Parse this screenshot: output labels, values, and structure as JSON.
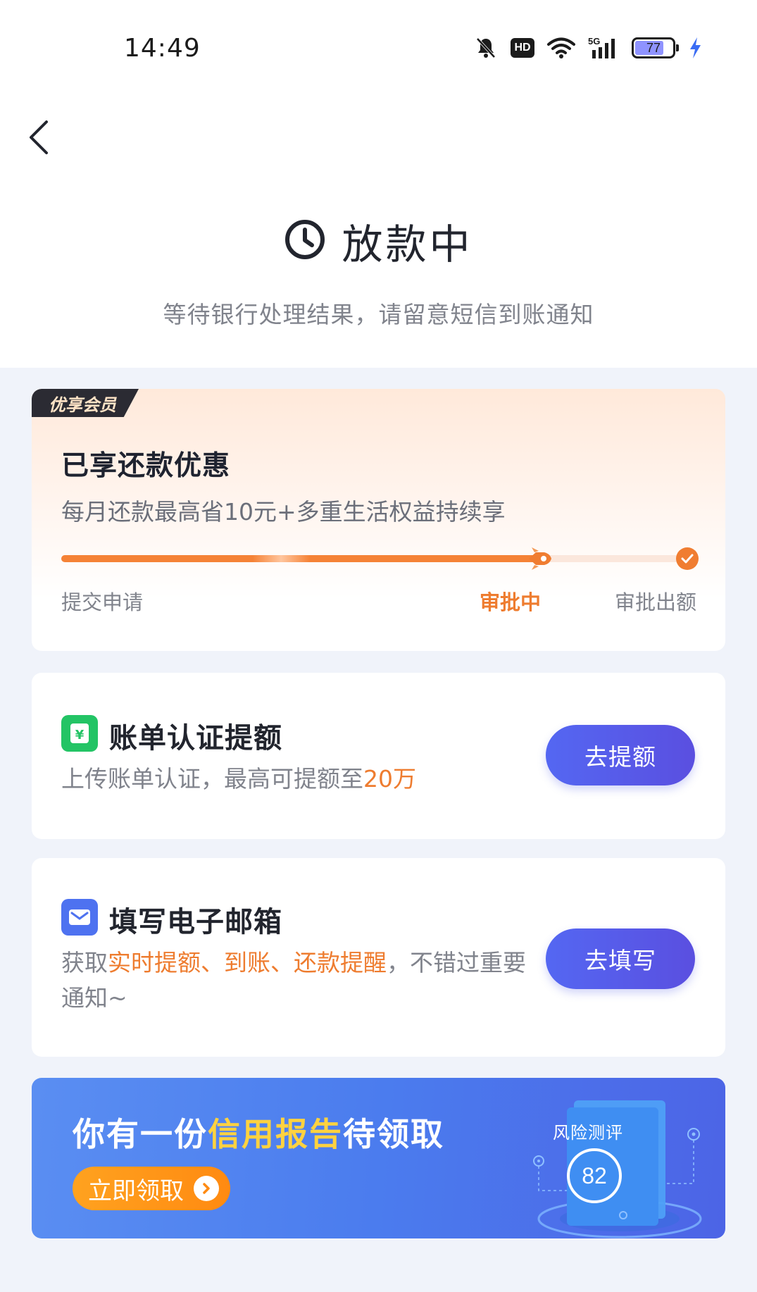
{
  "status_bar": {
    "time": "14:49",
    "network": "5G",
    "battery": "77"
  },
  "header": {
    "title": "放款中",
    "subtitle": "等待银行处理结果，请留意短信到账通知"
  },
  "member_card": {
    "tag": "优享会员",
    "title": "已享还款优惠",
    "description": "每月还款最高省10元+多重生活权益持续享",
    "progress": 0.75,
    "steps": [
      "提交申请",
      "审批中",
      "审批出额"
    ],
    "active_step": 1
  },
  "bill_card": {
    "title": "账单认证提额",
    "desc_prefix": "上传账单认证，最高可提额至",
    "desc_highlight": "20万",
    "button": "去提额"
  },
  "mail_card": {
    "title": "填写电子邮箱",
    "desc_part1": "获取",
    "desc_highlight": "实时提额、到账、还款提醒",
    "desc_part2": "，不错过重要通知~",
    "button": "去填写"
  },
  "banner": {
    "title_prefix": "你有一份",
    "title_highlight": "信用报告",
    "title_suffix": "待领取",
    "button": "立即领取",
    "report_label": "风险测评",
    "score": "82"
  },
  "colors": {
    "accent_orange": "#ee7c2f",
    "button_blue": "#5467f2",
    "banner_blue": "#4b7cee",
    "highlight_yellow": "#ffd23f"
  }
}
